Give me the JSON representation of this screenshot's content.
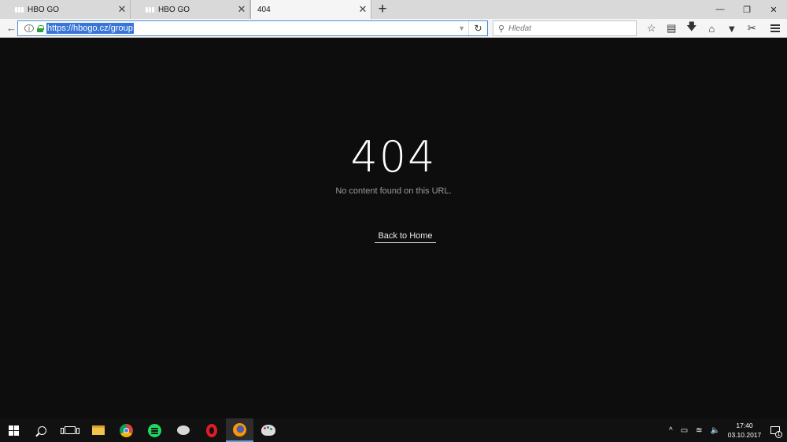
{
  "browser": {
    "tabs": [
      {
        "title": "HBO GO",
        "close": "✕",
        "active": false
      },
      {
        "title": "HBO GO",
        "close": "✕",
        "active": false
      },
      {
        "title": "404",
        "close": "✕",
        "active": true
      }
    ],
    "new_tab": "+",
    "window_controls": {
      "minimize": "—",
      "restore": "❐",
      "close": "✕"
    },
    "url": "https://hbogo.cz/group",
    "search_placeholder": "Hledat",
    "toolbar_icons": [
      "star-icon",
      "reading-list-icon",
      "download-icon",
      "home-icon",
      "pocket-icon",
      "screenshot-icon"
    ]
  },
  "page": {
    "error_code": "404",
    "message": "No content found on this URL.",
    "home_link": "Back to Home"
  },
  "taskbar": {
    "apps": [
      "start",
      "search",
      "task-view",
      "file-explorer",
      "chrome",
      "spotify",
      "skype-like",
      "opera",
      "firefox",
      "paint"
    ],
    "tray_chevron": "^",
    "time": "17:40",
    "date": "03.10.2017",
    "notification_count": "1"
  },
  "colors": {
    "page_background": "#0d0d0d",
    "heading": "#ffffff",
    "message": "#9a9a9a",
    "url_selection": "#3875d7"
  }
}
